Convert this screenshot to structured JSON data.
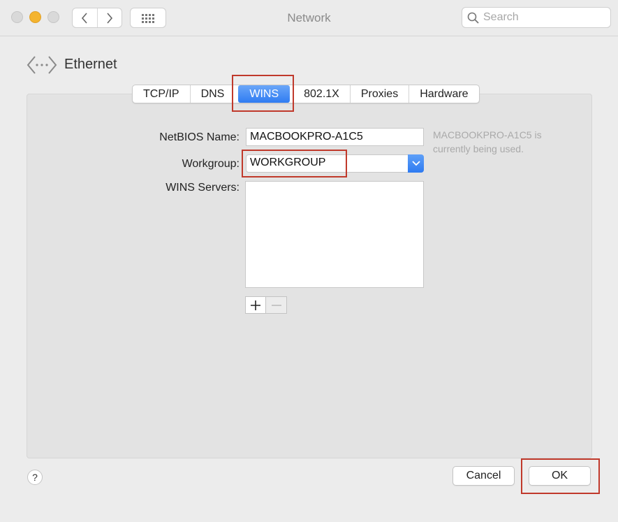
{
  "window": {
    "title": "Network",
    "search_placeholder": "Search"
  },
  "header": {
    "title": "Ethernet",
    "icon": "network-ethernet-icon"
  },
  "tabs": [
    {
      "label": "TCP/IP",
      "active": false
    },
    {
      "label": "DNS",
      "active": false
    },
    {
      "label": "WINS",
      "active": true
    },
    {
      "label": "802.1X",
      "active": false
    },
    {
      "label": "Proxies",
      "active": false
    },
    {
      "label": "Hardware",
      "active": false
    }
  ],
  "form": {
    "netbios_label": "NetBIOS Name:",
    "netbios_value": "MACBOOKPRO-A1C5",
    "netbios_hint_line1": "MACBOOKPRO-A1C5 is",
    "netbios_hint_line2": "currently being used.",
    "workgroup_label": "Workgroup:",
    "workgroup_value": "WORKGROUP",
    "wins_servers_label": "WINS Servers:",
    "wins_servers": []
  },
  "buttons": {
    "help": "?",
    "cancel": "Cancel",
    "ok": "OK"
  },
  "colors": {
    "accent": "#2f7cf2",
    "highlight": "#c0392b"
  }
}
